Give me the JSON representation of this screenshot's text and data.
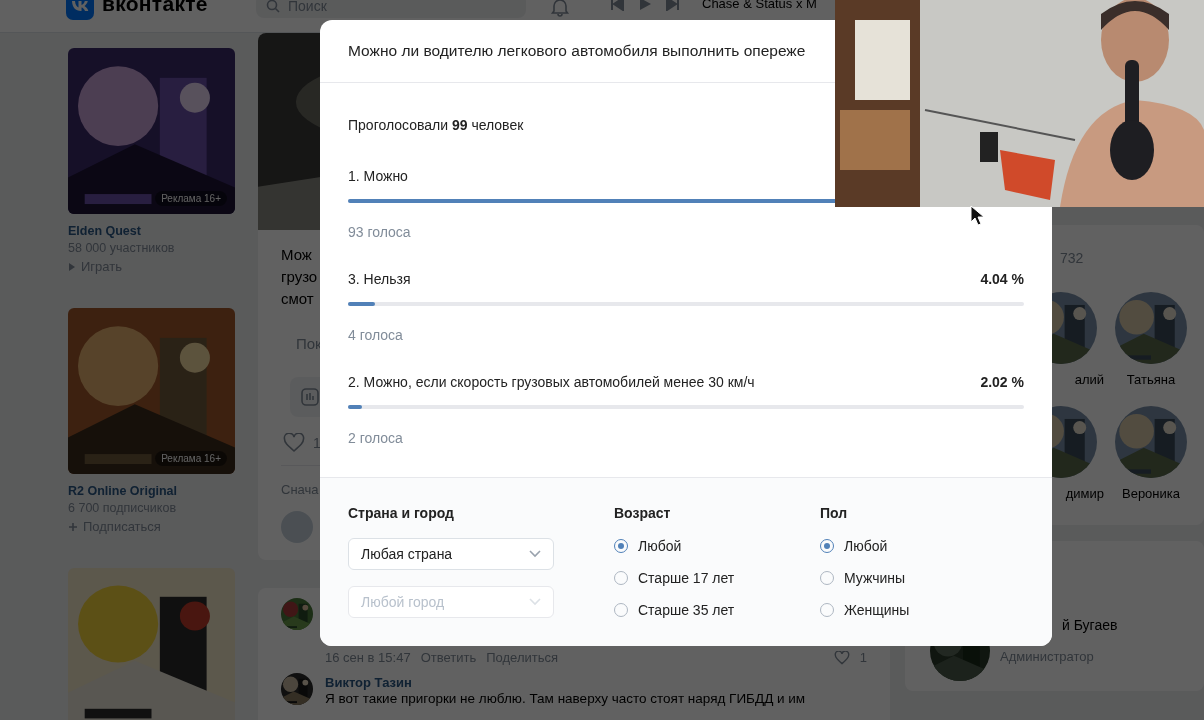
{
  "header": {
    "logo": "вконтакте",
    "search": {
      "placeholder": "Поиск"
    },
    "player": {
      "track": "Chase & Status x M"
    }
  },
  "ads": [
    {
      "kind": "game",
      "badge": "Реклама 16+",
      "title": "Elden Quest",
      "subtitle": "58 000 участников",
      "action": "Играть"
    },
    {
      "kind": "community",
      "badge": "Реклама 16+",
      "title": "R2 Online Original",
      "subtitle": "6 700 подписчиков",
      "action": "Подписаться"
    }
  ],
  "post": {
    "text_lines": [
      "Мож",
      "грузо",
      "смот"
    ],
    "more": "Пок",
    "likes": "1",
    "sort": "Снача"
  },
  "comments": [
    {
      "date": "16 сен в 15:47",
      "reply": "Ответить",
      "share": "Поделиться",
      "likes": "1"
    },
    {
      "author": "Виктор Тазин",
      "text": "Я вот такие пригорки не люблю. Там наверху часто стоят наряд ГИБДД и им"
    }
  ],
  "friends": {
    "count": "732",
    "people": [
      {
        "name": "алий"
      },
      {
        "name": "Татьяна"
      },
      {
        "name": "димир"
      },
      {
        "name": "Вероника"
      }
    ]
  },
  "contact": {
    "name": "й Бугаев",
    "role": "Администратор"
  },
  "poll": {
    "question": "Можно ли водителю легкового автомобиля выполнить опереже",
    "total": "Проголосовали **99** человек",
    "options": [
      {
        "label": "1. Можно",
        "level": 0.9394,
        "votes": "93 голоса"
      },
      {
        "label": "3. Нельзя",
        "percent": "4.04 %",
        "level": 0.0404,
        "votes": "4 голоса"
      },
      {
        "label": "2. Можно, если скорость грузовых автомобилей менее 30 км/ч",
        "percent": "2.02 %",
        "level": 0.0202,
        "votes": "2 голоса"
      }
    ],
    "filters": {
      "location": {
        "label": "Страна и город",
        "country": {
          "value": "Любая страна",
          "disabled": false
        },
        "city": {
          "placeholder": "Любой город",
          "disabled": true
        }
      },
      "age": {
        "label": "Возраст",
        "options": [
          {
            "label": "Любой",
            "selected": true
          },
          {
            "label": "Старше 17 лет",
            "selected": false
          },
          {
            "label": "Старше 35 лет",
            "selected": false
          }
        ]
      },
      "gender": {
        "label": "Пол",
        "options": [
          {
            "label": "Любой",
            "selected": true
          },
          {
            "label": "Мужчины",
            "selected": false
          },
          {
            "label": "Женщины",
            "selected": false
          }
        ]
      }
    }
  }
}
